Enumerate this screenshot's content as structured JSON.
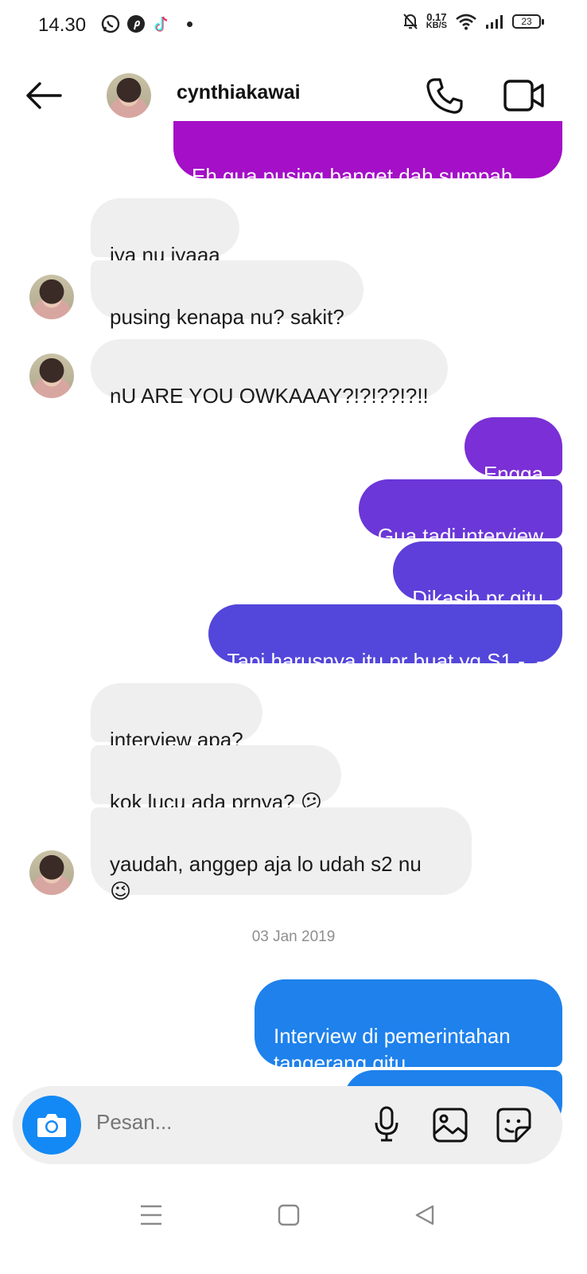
{
  "status_bar": {
    "time": "14.30",
    "speed_value": "0.17",
    "speed_unit": "KB/S",
    "battery": "23",
    "notification_icons": [
      "whatsapp-icon",
      "pinterest-icon",
      "tiktok-icon"
    ],
    "system_icons": [
      "mute-bell-icon",
      "wifi-icon",
      "signal-icon",
      "battery-icon"
    ]
  },
  "header": {
    "contact_name": "cynthiakawai",
    "icons": [
      "back-arrow-icon",
      "phone-icon",
      "video-camera-icon"
    ]
  },
  "messages": [
    {
      "id": 0,
      "direction": "out",
      "text": "Eh gua pusing banget dah sumpah",
      "color": "#a40fc7"
    },
    {
      "id": 1,
      "direction": "in",
      "text": "iya nu iyaaa"
    },
    {
      "id": 2,
      "direction": "in",
      "text": "pusing kenapa nu? sakit?"
    },
    {
      "id": 3,
      "direction": "in",
      "text": "nU ARE YOU OWKAAAY?!?!??!?!!"
    },
    {
      "id": 4,
      "direction": "out",
      "text": "Engga",
      "color": "#7b2fd6"
    },
    {
      "id": 5,
      "direction": "out",
      "text": "Gua tadi interview",
      "color": "#6b37d8"
    },
    {
      "id": 6,
      "direction": "out",
      "text": "Dikasih pr gitu",
      "color": "#5e3fd9"
    },
    {
      "id": 7,
      "direction": "out",
      "text": "Tapi harusnya itu pr buat yg S1 -_-",
      "color": "#5346da"
    },
    {
      "id": 8,
      "direction": "in",
      "text": "interview apa?"
    },
    {
      "id": 9,
      "direction": "in",
      "text": "kok lucu ada prnya? 😕"
    },
    {
      "id": 10,
      "direction": "in",
      "text": "yaudah, anggep aja lo udah s2 nu\n😉"
    },
    {
      "id": 11,
      "direction": "out",
      "text": "Interview di pemerintahan\ntangerang gitu",
      "color": "#1e81ec"
    },
    {
      "id": 12,
      "direction": "out",
      "text": "",
      "color": "#1e81ec"
    }
  ],
  "date_separator": "03 Jan 2019",
  "composer": {
    "placeholder": "Pesan...",
    "icons": [
      "camera-icon",
      "microphone-icon",
      "gallery-icon",
      "sticker-icon"
    ]
  },
  "nav_bar": {
    "icons": [
      "menu-icon",
      "home-square-icon",
      "back-triangle-icon"
    ]
  }
}
